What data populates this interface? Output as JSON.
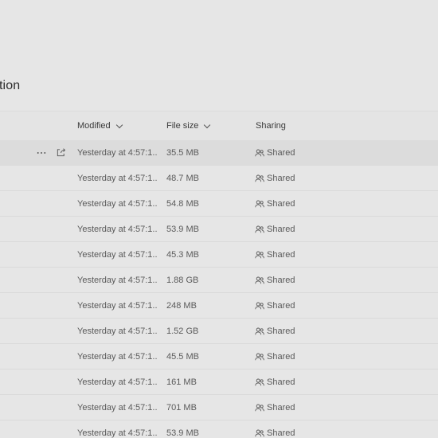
{
  "page": {
    "title_partial": "tion"
  },
  "columns": {
    "modified": "Modified",
    "file_size": "File size",
    "sharing": "Sharing"
  },
  "icons": {
    "sort": "chevron-down-icon",
    "more": "more-options-icon",
    "share": "share-icon",
    "shared": "people-icon"
  },
  "rows": [
    {
      "modified": "Yesterday at 4:57:1...",
      "size": "35.5 MB",
      "sharing": "Shared",
      "selected": true
    },
    {
      "modified": "Yesterday at 4:57:1...",
      "size": "48.7 MB",
      "sharing": "Shared"
    },
    {
      "modified": "Yesterday at 4:57:1...",
      "size": "54.8 MB",
      "sharing": "Shared"
    },
    {
      "modified": "Yesterday at 4:57:1...",
      "size": "53.9 MB",
      "sharing": "Shared"
    },
    {
      "modified": "Yesterday at 4:57:1...",
      "size": "45.3 MB",
      "sharing": "Shared"
    },
    {
      "modified": "Yesterday at 4:57:1...",
      "size": "1.88 GB",
      "sharing": "Shared"
    },
    {
      "modified": "Yesterday at 4:57:1...",
      "size": "248 MB",
      "sharing": "Shared"
    },
    {
      "modified": "Yesterday at 4:57:1...",
      "size": "1.52 GB",
      "sharing": "Shared"
    },
    {
      "modified": "Yesterday at 4:57:1...",
      "size": "45.5 MB",
      "sharing": "Shared"
    },
    {
      "modified": "Yesterday at 4:57:1...",
      "size": "161 MB",
      "sharing": "Shared"
    },
    {
      "modified": "Yesterday at 4:57:1...",
      "size": "701 MB",
      "sharing": "Shared"
    },
    {
      "modified": "Yesterday at 4:57:1...",
      "size": "53.9 MB",
      "sharing": "Shared"
    }
  ]
}
